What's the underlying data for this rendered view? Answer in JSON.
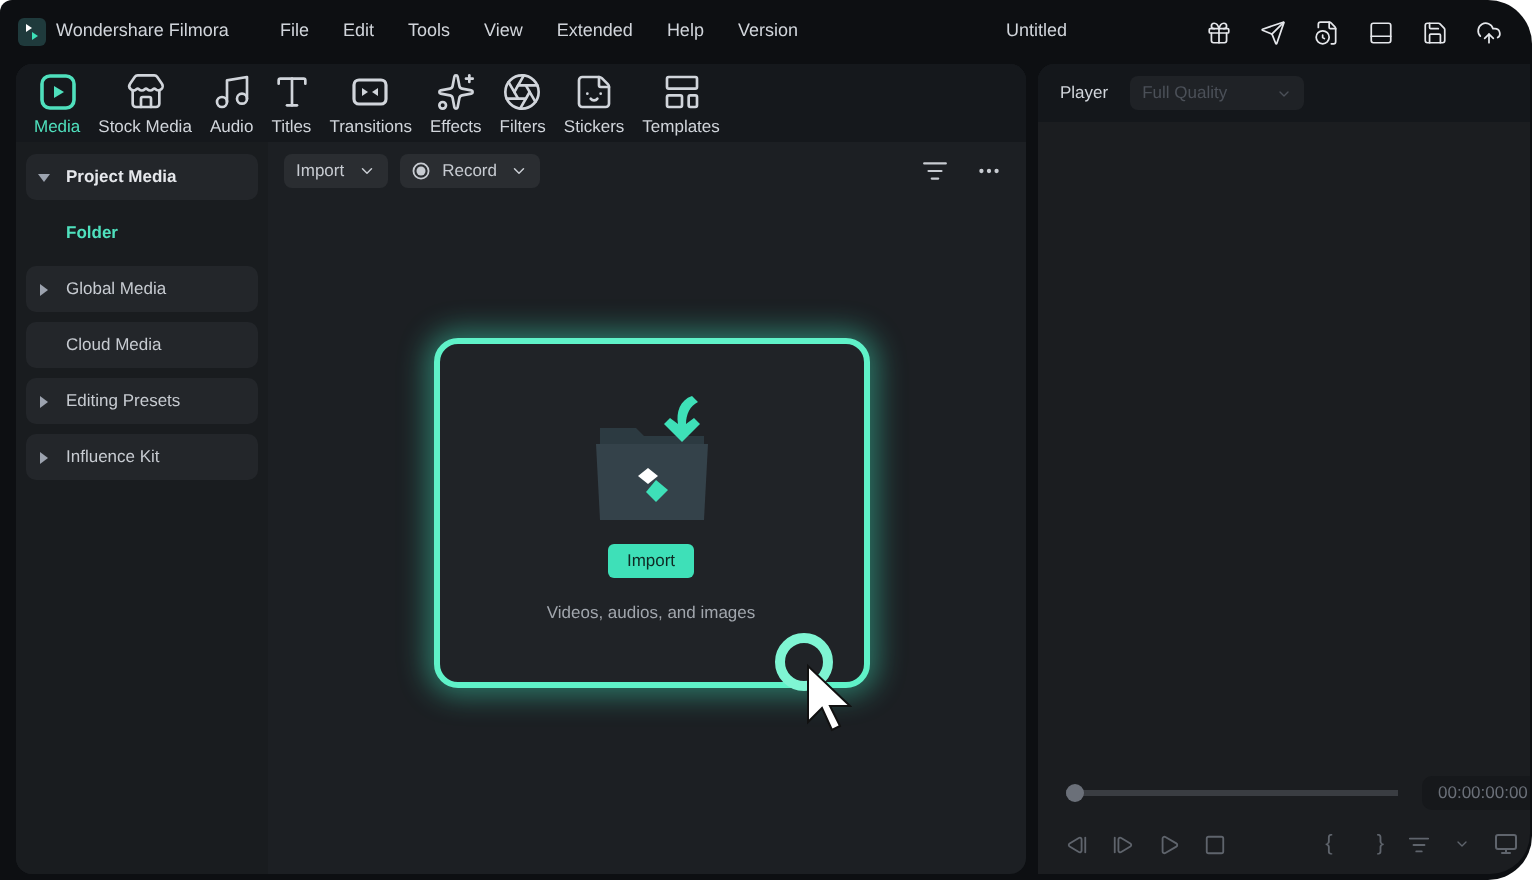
{
  "app": {
    "name": "Wondershare Filmora",
    "project_title": "Untitled"
  },
  "menu": [
    "File",
    "Edit",
    "Tools",
    "View",
    "Extended",
    "Help",
    "Version"
  ],
  "tabs": [
    {
      "label": "Media",
      "selected": true
    },
    {
      "label": "Stock Media",
      "selected": false
    },
    {
      "label": "Audio",
      "selected": false
    },
    {
      "label": "Titles",
      "selected": false
    },
    {
      "label": "Transitions",
      "selected": false
    },
    {
      "label": "Effects",
      "selected": false
    },
    {
      "label": "Filters",
      "selected": false
    },
    {
      "label": "Stickers",
      "selected": false
    },
    {
      "label": "Templates",
      "selected": false
    }
  ],
  "sidebar": [
    {
      "label": "Project Media",
      "kind": "group",
      "expanded": true,
      "children": [
        {
          "label": "Folder",
          "selected": true
        }
      ]
    },
    {
      "label": "Global Media",
      "kind": "group",
      "expanded": false
    },
    {
      "label": "Cloud Media",
      "kind": "plain"
    },
    {
      "label": "Editing Presets",
      "kind": "group",
      "expanded": false
    },
    {
      "label": "Influence Kit",
      "kind": "group",
      "expanded": false
    }
  ],
  "toolbar": {
    "import": "Import",
    "record": "Record"
  },
  "drop_zone": {
    "button": "Import",
    "hint": "Videos, audios, and images",
    "highlighted": true
  },
  "player": {
    "label": "Player",
    "quality": "Full Quality",
    "quality_disabled": true,
    "level": 0,
    "timecode": "00:00:00:00",
    "mark_in": "{",
    "mark_out": "}"
  }
}
